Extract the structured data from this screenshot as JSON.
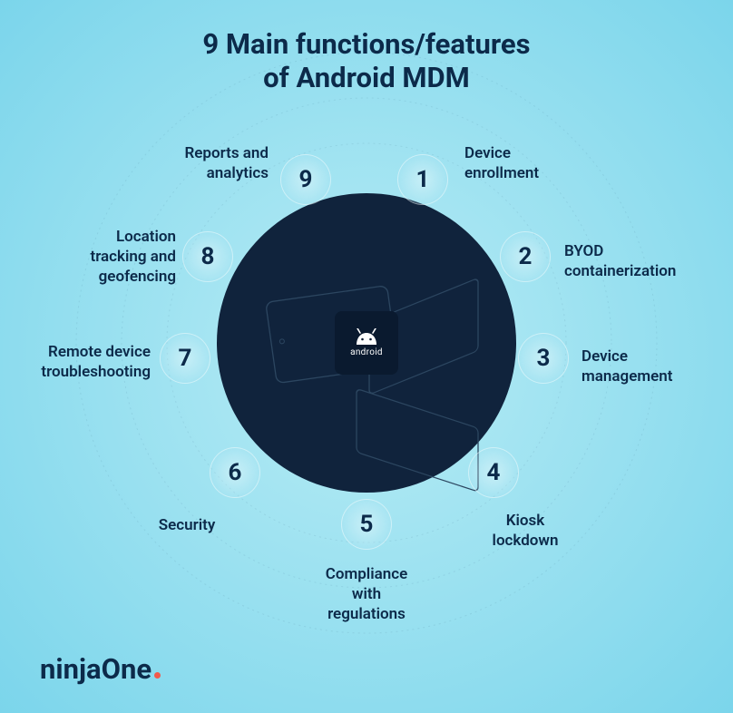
{
  "title_line1": "9 Main functions/features",
  "title_line2": "of Android MDM",
  "center_label": "android",
  "items": [
    "1",
    "2",
    "3",
    "4",
    "5",
    "6",
    "7",
    "8",
    "9"
  ],
  "labels": [
    "Device enrollment",
    "BYOD containerization",
    "Device management",
    "Kiosk lockdown",
    "Compliance with regulations",
    "Security",
    "Remote device troubleshooting",
    "Location tracking and geofencing",
    "Reports and analytics"
  ],
  "logo_part1": "ninja",
  "logo_part2": "One"
}
